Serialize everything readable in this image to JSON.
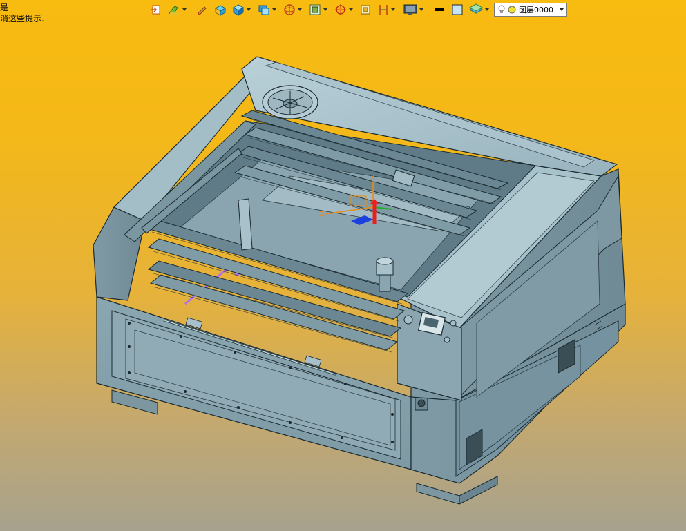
{
  "hint": {
    "line1": "是",
    "line2": "消这些提示."
  },
  "toolbar": {
    "buttons": [
      {
        "name": "exit-sketch-icon",
        "dropdown": false
      },
      {
        "name": "sketch-paint-icon",
        "dropdown": true
      },
      {
        "name": "pen-edit-icon",
        "dropdown": false
      },
      {
        "name": "solid-tools-icon",
        "dropdown": false
      },
      {
        "name": "cube-view-icon",
        "dropdown": true
      },
      {
        "name": "display-style-icon",
        "dropdown": true
      },
      {
        "name": "render-sphere-icon",
        "dropdown": true
      },
      {
        "name": "zoom-fit-icon",
        "dropdown": true
      },
      {
        "name": "target-snap-icon",
        "dropdown": true
      },
      {
        "name": "section-view-icon",
        "dropdown": false
      },
      {
        "name": "dimension-icon",
        "dropdown": true
      },
      {
        "name": "monitor-icon",
        "dropdown": true
      },
      {
        "name": "line-black-icon",
        "dropdown": false
      },
      {
        "name": "fill-color-icon",
        "dropdown": false
      },
      {
        "name": "layer-stack-icon",
        "dropdown": true
      }
    ],
    "layer_select": {
      "value": "图层0000"
    }
  },
  "colors": {
    "bg_top": "#f8bb10",
    "bg_bottom": "#a6a28e",
    "machine_body": "#9fb9c3",
    "machine_dark": "#6d8894",
    "edge": "#1a2a30",
    "purple_highlight": "#b070f0",
    "triad_red": "#e82020",
    "triad_blue": "#1a40e0",
    "triad_green": "#20b030",
    "triad_orange": "#f08a10"
  }
}
